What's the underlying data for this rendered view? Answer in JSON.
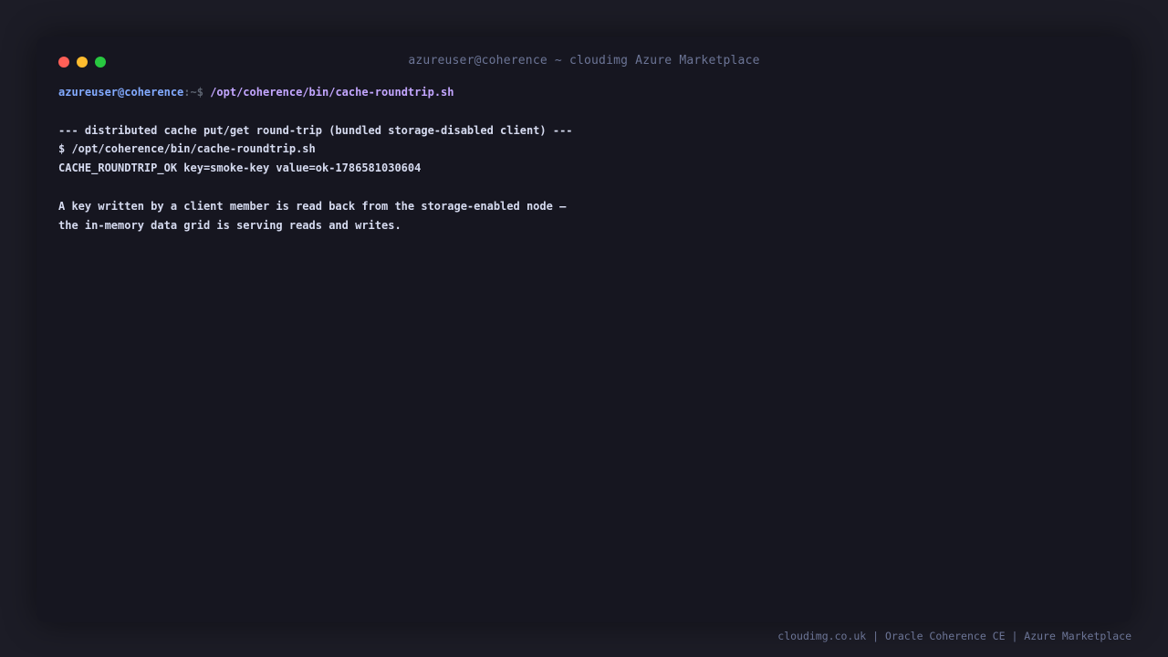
{
  "window": {
    "title": "azureuser@coherence ~ cloudimg Azure Marketplace",
    "controls": [
      {
        "name": "close",
        "color": "#ff5f57"
      },
      {
        "name": "minimize",
        "color": "#febc2e"
      },
      {
        "name": "maximize",
        "color": "#28c840"
      }
    ]
  },
  "prompt": {
    "user_host": "azureuser@coherence",
    "path_symbol": ":~$ ",
    "command": "/opt/coherence/bin/cache-roundtrip.sh"
  },
  "output": {
    "header": "--- distributed cache put/get round-trip (bundled storage-disabled client) ---",
    "echo_command": "$ /opt/coherence/bin/cache-roundtrip.sh",
    "result": "CACHE_ROUNDTRIP_OK key=smoke-key value=ok-1786581030604",
    "note_line_1": "A key written by a client member is read back from the storage-enabled node —",
    "note_line_2": "the in-memory data grid is serving reads and writes."
  },
  "footer": {
    "credit": "cloudimg.co.uk | Oracle Coherence CE | Azure Marketplace"
  },
  "colors": {
    "page_background": "#1c1c26",
    "terminal_background": "#161620",
    "title_text": "#6c7596",
    "user_host": "#82aaff",
    "prompt_symbol": "#5c6370",
    "command": "#c3a6ff",
    "output_text": "#d6dbf0",
    "footer_text": "#6c7596"
  }
}
